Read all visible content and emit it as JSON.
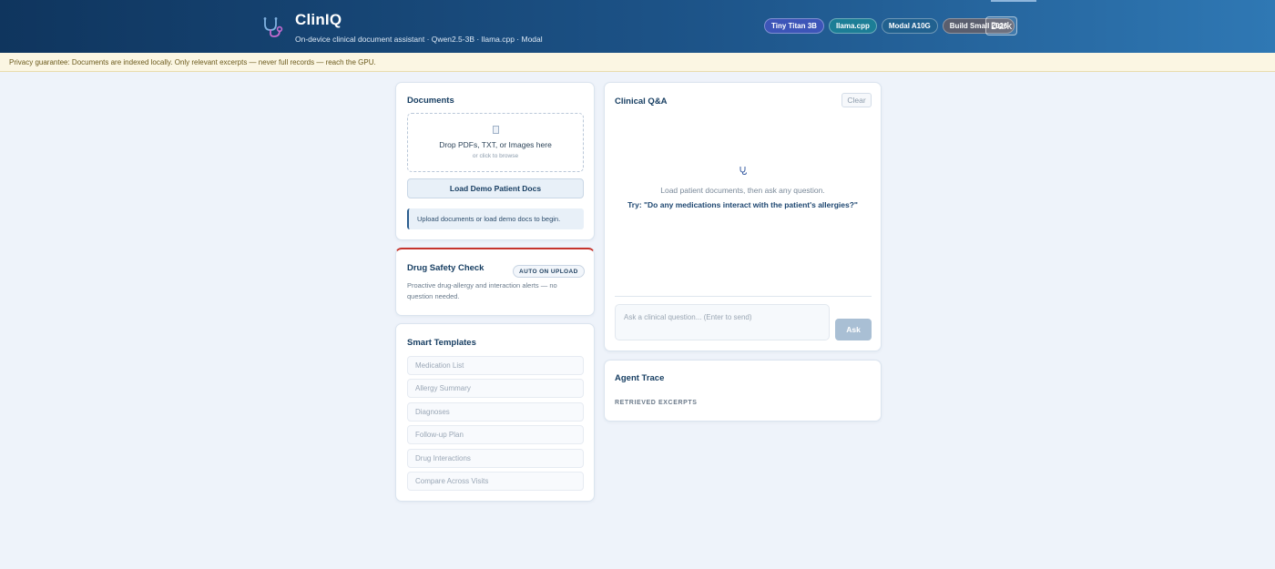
{
  "header": {
    "title": "ClinIQ",
    "subtitle": "On-device clinical document assistant · Qwen2.5-3B · llama.cpp · Modal",
    "badges": [
      "Tiny Titan 3B",
      "llama.cpp",
      "Modal A10G",
      "Build Small 2026"
    ],
    "theme_toggle": "Dark",
    "icon": "stethoscope-icon"
  },
  "privacy": {
    "text": "Privacy guarantee: Documents are indexed locally. Only relevant excerpts — never full records — reach the GPU."
  },
  "documents": {
    "title": "Documents",
    "dropzone_main": "Drop PDFs, TXT, or Images here",
    "dropzone_sub": "or click to browse",
    "demo_button": "Load Demo Patient Docs",
    "status": "Upload documents or load demo docs to begin."
  },
  "drug_safety": {
    "title": "Drug Safety Check",
    "badge": "AUTO ON UPLOAD",
    "description": "Proactive drug-allergy and interaction alerts — no question needed.",
    "accent_color": "#c5332c"
  },
  "templates": {
    "title": "Smart Templates",
    "items": [
      "Medication List",
      "Allergy Summary",
      "Diagnoses",
      "Follow-up Plan",
      "Drug Interactions",
      "Compare Across Visits"
    ]
  },
  "qa": {
    "title": "Clinical Q&A",
    "clear_button": "Clear",
    "hint": "Load patient documents, then ask any question.",
    "example": "Try: \"Do any medications interact with the patient's allergies?\"",
    "input_placeholder": "Ask a clinical question... (Enter to send)",
    "ask_button": "Ask"
  },
  "trace": {
    "title": "Agent Trace",
    "section_label": "RETRIEVED EXCERPTS"
  },
  "colors": {
    "header_start": "#0f355e",
    "header_end": "#2f78b4",
    "background": "#eef3fa",
    "accent": "#173e62"
  }
}
